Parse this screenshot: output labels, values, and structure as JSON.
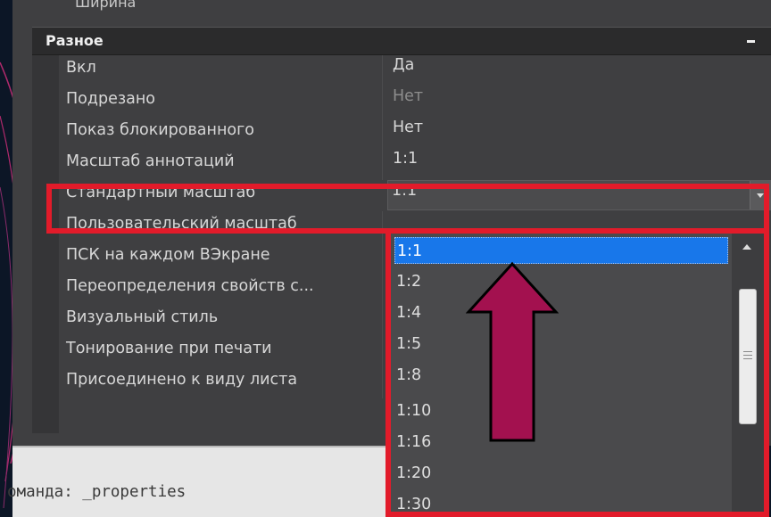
{
  "top_clipped_label": "Ширина",
  "section": {
    "title": "Разное",
    "collapse_icon": "minus-icon"
  },
  "properties": [
    {
      "name": "Вкл",
      "value": "Да"
    },
    {
      "name": "Подрезано",
      "value": "Нет"
    },
    {
      "name": "Показ блокированного",
      "value": "Нет"
    },
    {
      "name": "Масштаб аннотаций",
      "value": "1:1"
    },
    {
      "name": "Стандартный масштаб",
      "value": "1:1"
    },
    {
      "name": "Пользовательский масштаб",
      "value": ""
    },
    {
      "name": "ПСК на каждом ВЭкране",
      "value": ""
    },
    {
      "name": "Переопределения свойств с...",
      "value": ""
    },
    {
      "name": "Визуальный стиль",
      "value": ""
    },
    {
      "name": "Тонирование при печати",
      "value": ""
    },
    {
      "name": "Присоединено к виду листа",
      "value": ""
    }
  ],
  "dropdown": {
    "options": [
      "1:1",
      "1:2",
      "1:4",
      "1:5",
      "1:8",
      "1:10",
      "1:16",
      "1:20",
      "1:30"
    ],
    "selected": "1:1",
    "scroll_up_icon": "scroll-up-arrow-icon",
    "scroll_thumb_icon": "scroll-thumb-grip-icon"
  },
  "annotation": {
    "arrow_icon": "up-arrow-icon",
    "colors": {
      "highlight": "#e21b2a",
      "arrow": "#a3114f"
    }
  },
  "command_line": {
    "text": "оманда:  _properties"
  }
}
